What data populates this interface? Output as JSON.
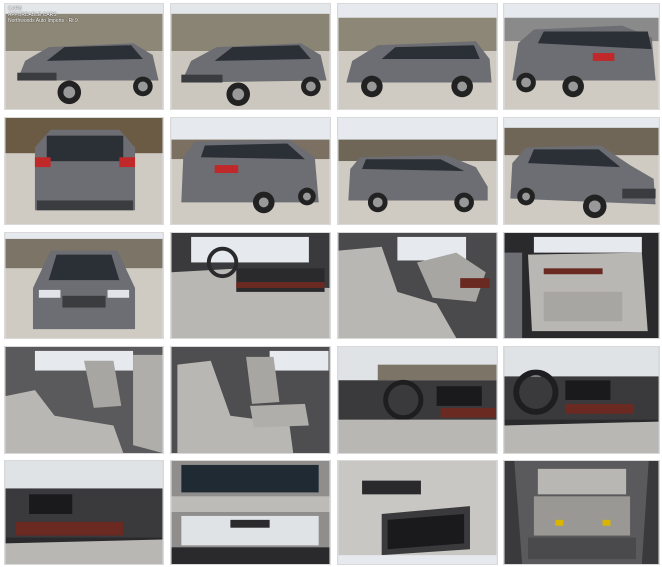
{
  "gallery": {
    "watermark": {
      "line1": "CARS",
      "line2": "AFFORDABLE CARS",
      "line3": "Northwoods Auto Imports · Rt 9"
    },
    "colors": {
      "sky": "#e6eaee",
      "ground": "#cfcac2",
      "van_body": "#6d6e73",
      "van_dark": "#3b3c40",
      "glass": "#2b2f36",
      "taillight": "#c0282a",
      "interior_leather": "#b9b7b3",
      "dash_dark": "#2a2a2c",
      "wood": "#6a2a22"
    },
    "photos": [
      {
        "view": "front-left-exterior"
      },
      {
        "view": "front-left-exterior-alt"
      },
      {
        "view": "left-side-exterior"
      },
      {
        "view": "rear-left-exterior"
      },
      {
        "view": "rear-exterior"
      },
      {
        "view": "rear-left-angle-exterior"
      },
      {
        "view": "right-side-exterior"
      },
      {
        "view": "front-right-exterior"
      },
      {
        "view": "front-exterior"
      },
      {
        "view": "driver-door-interior"
      },
      {
        "view": "front-seats-interior"
      },
      {
        "view": "driver-door-panel"
      },
      {
        "view": "second-row-seats"
      },
      {
        "view": "captain-chairs"
      },
      {
        "view": "dashboard-passenger"
      },
      {
        "view": "dashboard-steering"
      },
      {
        "view": "center-console"
      },
      {
        "view": "moonroof"
      },
      {
        "view": "rear-entertainment-screen"
      },
      {
        "view": "cargo-area"
      }
    ]
  }
}
